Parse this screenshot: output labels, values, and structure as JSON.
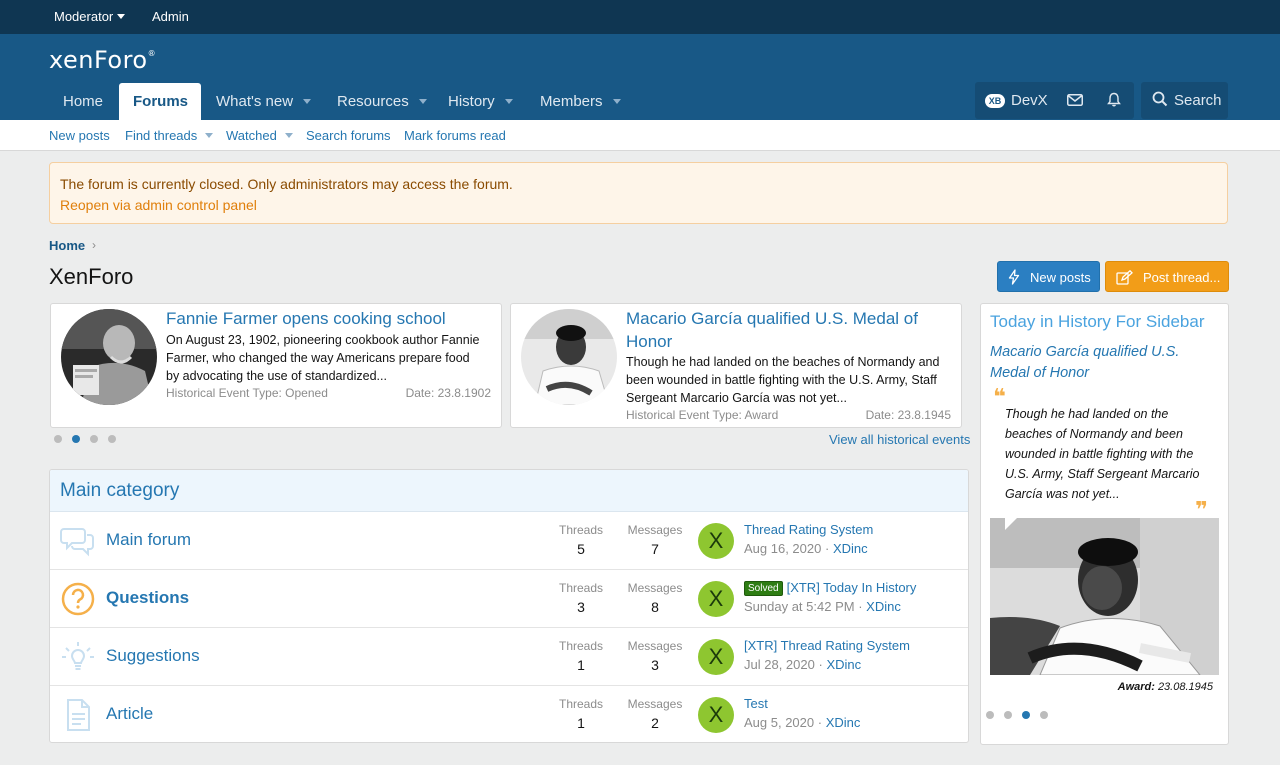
{
  "staffbar": {
    "moderator": "Moderator",
    "admin": "Admin"
  },
  "header": {
    "logo": "xenForo",
    "logo_mark": "®",
    "nav": [
      {
        "label": "Home"
      },
      {
        "label": "Forums"
      },
      {
        "label": "What's new"
      },
      {
        "label": "Resources"
      },
      {
        "label": "History"
      },
      {
        "label": "Members"
      }
    ],
    "user": "DevX",
    "user_badge": "XB",
    "search": "Search"
  },
  "subnav": [
    "New posts",
    "Find threads",
    "Watched",
    "Search forums",
    "Mark forums read"
  ],
  "notice": {
    "text": "The forum is currently closed. Only administrators may access the forum.",
    "link": "Reopen via admin control panel"
  },
  "breadcrumb": "Home",
  "breadcrumb_sep": "›",
  "page_title": "XenForo",
  "buttons": {
    "new_posts": "New posts",
    "post_thread": "Post thread..."
  },
  "events": [
    {
      "title": "Fannie Farmer opens cooking school",
      "lines": [
        "On August 23, 1902, pioneering cookbook author Fannie",
        "Farmer, who changed the way Americans prepare food",
        "by advocating the use of standardized..."
      ],
      "meta": "Historical Event Type: Opened",
      "date": "Date: 23.8.1902"
    },
    {
      "title_lines": [
        "Macario García qualified U.S. Medal of",
        "Honor"
      ],
      "lines": [
        "Though he had landed on the beaches of Normandy and",
        "been wounded in battle fighting with the U.S. Army, Staff",
        "Sergeant Marcario García was not yet..."
      ],
      "meta": "Historical Event Type: Award",
      "date": "Date: 23.8.1945"
    }
  ],
  "view_all": "View all historical events",
  "category": {
    "title": "Main category",
    "threads_label": "Threads",
    "messages_label": "Messages",
    "forums": [
      {
        "name": "Main forum",
        "threads": "5",
        "messages": "7",
        "avatar": "X",
        "last_title": "Thread Rating System",
        "last_date": "Aug 16, 2020",
        "last_user": "XDinc"
      },
      {
        "name": "Questions",
        "threads": "3",
        "messages": "8",
        "avatar": "X",
        "prefix": "Solved",
        "last_title": "[XTR] Today In History",
        "last_date": "Sunday at 5:42 PM",
        "last_user": "XDinc"
      },
      {
        "name": "Suggestions",
        "threads": "1",
        "messages": "3",
        "avatar": "X",
        "last_title": "[XTR] Thread Rating System",
        "last_date": "Jul 28, 2020",
        "last_user": "XDinc"
      },
      {
        "name": "Article",
        "threads": "1",
        "messages": "2",
        "avatar": "X",
        "last_title": "Test",
        "last_date": "Aug 5, 2020",
        "last_user": "XDinc"
      }
    ],
    "sep": "·"
  },
  "sidebar": {
    "title": "Today in History For Sidebar",
    "headline_lines": [
      "Macario García qualified U.S.",
      "Medal of Honor"
    ],
    "quote_lines": [
      "Though he had landed on the",
      "beaches of Normandy and been",
      "wounded in battle fighting with the",
      "U.S. Army, Staff Sergeant Marcario",
      "García was not yet..."
    ],
    "award_label": "Award:",
    "award_date": "23.08.1945",
    "quote_open": "❝",
    "quote_close": "❞"
  },
  "colors": {
    "header": "#185886",
    "staffbar": "#0f3652",
    "accent": "#2577b1",
    "post_button": "#f29d18",
    "notice_bg": "#fef5e9"
  }
}
